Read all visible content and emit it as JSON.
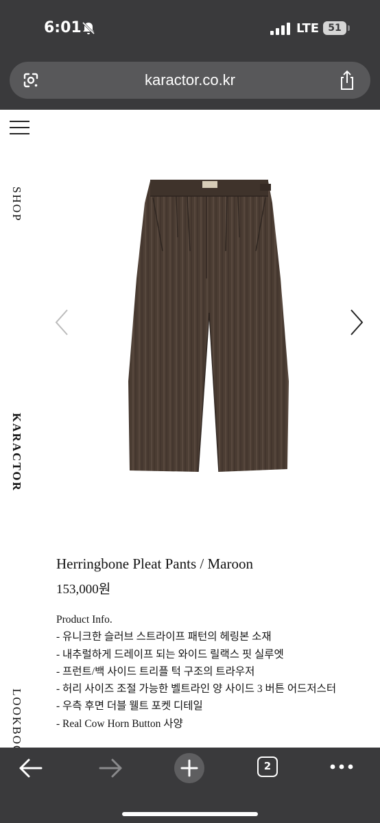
{
  "status_bar": {
    "time": "6:01",
    "network": "LTE",
    "battery": "51"
  },
  "browser": {
    "url": "karactor.co.kr",
    "tab_count": "2"
  },
  "side_nav": {
    "shop": "SHOP",
    "brand": "KARACTOR",
    "lookbook": "LOOKBOOK"
  },
  "product": {
    "name": "Herringbone Pleat Pants / Maroon",
    "price": "153,000원",
    "info_title": "Product Info.",
    "details": [
      "- 유니크한 슬러브 스트라이프 패턴의 헤링본 소재",
      "- 내추럴하게 드레이프 되는 와이드 릴랙스 핏 실루엣",
      "- 프런트/백 사이드 트리플 턱 구조의 트라우저",
      "- 허리 사이즈 조절 가능한 벨트라인 양 사이드 3 버튼 어드저스터",
      "- 우측 후면 더블 웰트 포켓 디테일",
      "- Real Cow Horn Button 사양"
    ]
  },
  "colors": {
    "chrome": "#3a3a3c",
    "url_field": "#58585a",
    "fabric": "#4b3d33"
  }
}
